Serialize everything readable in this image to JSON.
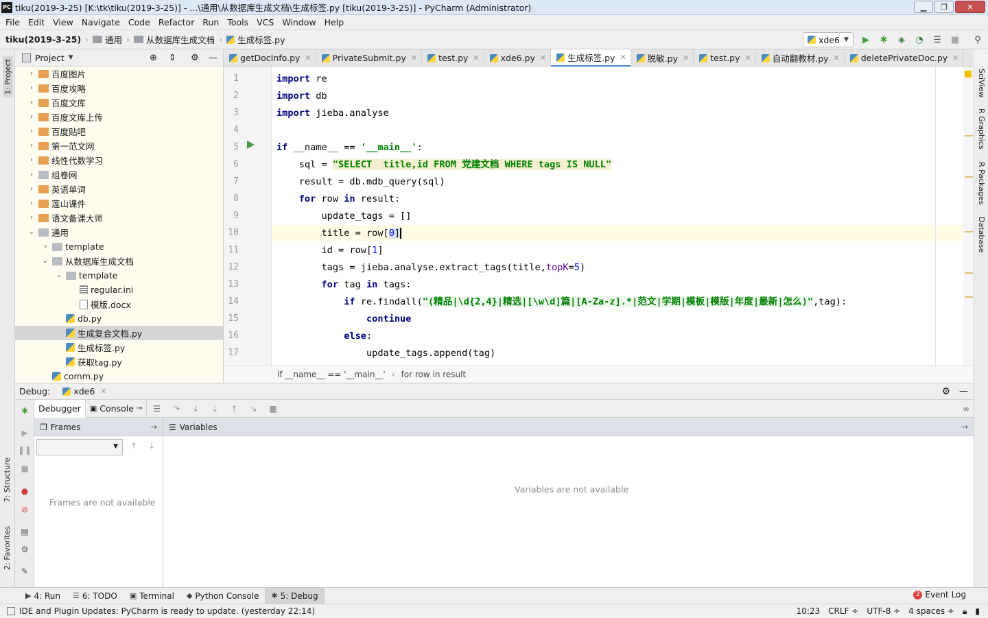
{
  "window": {
    "title": "tiku(2019-3-25) [K:\\tk\\tiku(2019-3-25)] - ...\\通用\\从数据库生成文档\\生成标签.py [tiku(2019-3-25)] - PyCharm (Administrator)",
    "app_icon": "PC"
  },
  "menu": [
    "File",
    "Edit",
    "View",
    "Navigate",
    "Code",
    "Refactor",
    "Run",
    "Tools",
    "VCS",
    "Window",
    "Help"
  ],
  "breadcrumb": [
    "tiku(2019-3-25)",
    "通用",
    "从数据库生成文档",
    "生成标签.py"
  ],
  "run_config": "xde6",
  "left_strip": {
    "project": "1: Project",
    "structure": "7: Structure",
    "favorites": "2: Favorites"
  },
  "right_strip": [
    "SciView",
    "R Graphics",
    "R Packages",
    "Database"
  ],
  "project": {
    "title": "Project",
    "tree": [
      {
        "label": "百度图片",
        "depth": 1,
        "type": "folder-orange",
        "arrow": "›"
      },
      {
        "label": "百度攻略",
        "depth": 1,
        "type": "folder-orange",
        "arrow": "›"
      },
      {
        "label": "百度文库",
        "depth": 1,
        "type": "folder-orange",
        "arrow": "›"
      },
      {
        "label": "百度文库上传",
        "depth": 1,
        "type": "folder-orange",
        "arrow": "›"
      },
      {
        "label": "百度贴吧",
        "depth": 1,
        "type": "folder-orange",
        "arrow": "›"
      },
      {
        "label": "第一范文网",
        "depth": 1,
        "type": "folder-orange",
        "arrow": "›"
      },
      {
        "label": "线性代数学习",
        "depth": 1,
        "type": "folder-orange",
        "arrow": "›"
      },
      {
        "label": "组卷网",
        "depth": 1,
        "type": "folder-gray",
        "arrow": "›"
      },
      {
        "label": "英语单词",
        "depth": 1,
        "type": "folder-orange",
        "arrow": "›"
      },
      {
        "label": "莲山课件",
        "depth": 1,
        "type": "folder-orange",
        "arrow": "›"
      },
      {
        "label": "语文备课大师",
        "depth": 1,
        "type": "folder-orange",
        "arrow": "›"
      },
      {
        "label": "通用",
        "depth": 1,
        "type": "folder-gray",
        "arrow": "⌄"
      },
      {
        "label": "template",
        "depth": 2,
        "type": "folder-gray",
        "arrow": "›"
      },
      {
        "label": "从数据库生成文档",
        "depth": 2,
        "type": "folder-gray",
        "arrow": "⌄"
      },
      {
        "label": "template",
        "depth": 3,
        "type": "folder-gray",
        "arrow": "⌄"
      },
      {
        "label": "regular.ini",
        "depth": 4,
        "type": "ini",
        "arrow": ""
      },
      {
        "label": "模版.docx",
        "depth": 4,
        "type": "doc",
        "arrow": ""
      },
      {
        "label": "db.py",
        "depth": 3,
        "type": "py",
        "arrow": ""
      },
      {
        "label": "生成复合文档.py",
        "depth": 3,
        "type": "py",
        "arrow": "",
        "selected": true
      },
      {
        "label": "生成标签.py",
        "depth": 3,
        "type": "py",
        "arrow": ""
      },
      {
        "label": "获取tag.py",
        "depth": 3,
        "type": "py",
        "arrow": ""
      },
      {
        "label": "comm.py",
        "depth": 2,
        "type": "py",
        "arrow": ""
      }
    ]
  },
  "tabs": [
    {
      "label": "getDocInfo.py"
    },
    {
      "label": "PrivateSubmit.py"
    },
    {
      "label": "test.py"
    },
    {
      "label": "xde6.py"
    },
    {
      "label": "生成标签.py",
      "active": true
    },
    {
      "label": "脱敏.py"
    },
    {
      "label": "test.py"
    },
    {
      "label": "自动翻教材.py"
    },
    {
      "label": "deletePrivateDoc.py"
    }
  ],
  "code": {
    "line_numbers": [
      "1",
      "2",
      "3",
      "4",
      "5",
      "6",
      "7",
      "8",
      "9",
      "10",
      "11",
      "12",
      "13",
      "14",
      "15",
      "16",
      "17"
    ],
    "l1a": "import",
    "l1b": " re",
    "l2a": "import",
    "l2b": " db",
    "l3a": "import",
    "l3b": " jieba.analyse",
    "l5a": "if",
    "l5b": " __name__ == ",
    "l5c": "'__main__'",
    "l5d": ":",
    "l6a": "    sql = ",
    "l6b": "\"SELECT  title,id FROM 党建文档 WHERE tags IS NULL\"",
    "l7": "    result = db.mdb_query(sql)",
    "l8a": "    ",
    "l8b": "for",
    "l8c": " row ",
    "l8d": "in",
    "l8e": " result:",
    "l9": "        update_tags = []",
    "l10a": "        title = row[",
    "l10b": "0",
    "l10c": "]",
    "l11a": "        id = row[",
    "l11b": "1",
    "l11c": "]",
    "l12a": "        tags = jieba.analyse.extract_tags(title,",
    "l12b": "topK",
    "l12c": "=",
    "l12d": "5",
    "l12e": ")",
    "l13a": "        ",
    "l13b": "for",
    "l13c": " tag ",
    "l13d": "in",
    "l13e": " tags:",
    "l14a": "            ",
    "l14b": "if",
    "l14c": " re.findall(",
    "l14d": "\"(精品|\\d{2,4}|精选|[\\w\\d]篇|[A-Za-z].*|范文|学期|模板|模版|年度|最新|怎么)\"",
    "l14e": ",tag):",
    "l15a": "                ",
    "l15b": "continue",
    "l16a": "            ",
    "l16b": "else",
    "l16c": ":",
    "l17": "                update_tags.append(tag)"
  },
  "code_breadcrumb": [
    "if __name__ == '__main__'",
    "for row in result"
  ],
  "debug": {
    "label": "Debug:",
    "config": "xde6",
    "tabs": [
      "Debugger",
      "Console"
    ],
    "frames_title": "Frames",
    "variables_title": "Variables",
    "frames_empty": "Frames are not available",
    "variables_empty": "Variables are not available"
  },
  "tool_windows": [
    {
      "label": "4: Run",
      "icon": "▶"
    },
    {
      "label": "6: TODO",
      "icon": "☰"
    },
    {
      "label": "Terminal",
      "icon": "▣"
    },
    {
      "label": "Python Console",
      "icon": "◆"
    },
    {
      "label": "5: Debug",
      "icon": "✱",
      "active": true
    }
  ],
  "event_log": {
    "label": "Event Log",
    "count": "2"
  },
  "status": {
    "message": "IDE and Plugin Updates: PyCharm is ready to update. (yesterday 22:14)",
    "position": "10:23",
    "line_sep": "CRLF ÷",
    "encoding": "UTF-8 ÷",
    "indent": "4 spaces ÷"
  }
}
